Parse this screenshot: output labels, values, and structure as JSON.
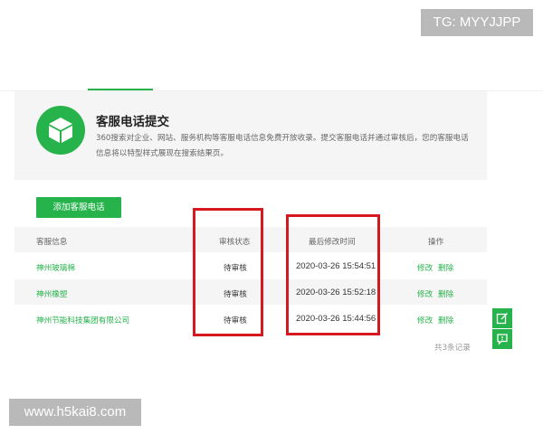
{
  "watermarks": {
    "top": "TG: MYYJJPP",
    "bottom": "www.h5kai8.com"
  },
  "banner": {
    "icon": "cube-icon",
    "title": "客服电话提交",
    "description": "360搜索对企业、网站、服务机构等客服电话信息免费开放收录。提交客服电话并通过审核后，您的客服电话信息将以特型样式展现在搜索结果页。"
  },
  "toolbar": {
    "add_label": "添加客服电话"
  },
  "table": {
    "headers": [
      "客服信息",
      "审核状态",
      "最后修改时间",
      "操作"
    ],
    "rows": [
      {
        "name": "神州玻璃棉",
        "status": "待审核",
        "time": "2020-03-26 15:54:51",
        "edit": "修改",
        "delete": "删除"
      },
      {
        "name": "神州橡塑",
        "status": "待审核",
        "time": "2020-03-26 15:52:18",
        "edit": "修改",
        "delete": "删除"
      },
      {
        "name": "神州节能科技集团有限公司",
        "status": "待审核",
        "time": "2020-03-26 15:44:56",
        "edit": "修改",
        "delete": "删除"
      }
    ]
  },
  "pagination": {
    "text": "共3条记录"
  },
  "floating": {
    "icons": [
      "edit-note-icon",
      "feedback-icon"
    ]
  },
  "colors": {
    "brand": "#27b34b",
    "highlight": "#d7191f"
  }
}
